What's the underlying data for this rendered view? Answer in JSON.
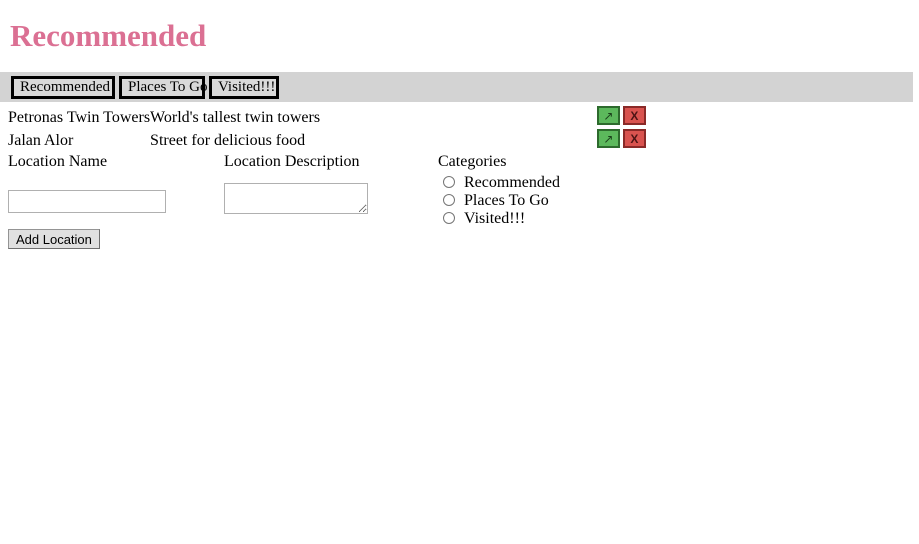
{
  "page": {
    "title": "Recommended",
    "title_color": "#db7093"
  },
  "navbar": {
    "background_color": "#d3d3d3",
    "buttons": [
      {
        "label": "Recommended"
      },
      {
        "label": "Places To Go"
      },
      {
        "label": "Visited!!!"
      }
    ]
  },
  "locations": {
    "rows": [
      {
        "name": "Petronas Twin Towers",
        "description": "World's tallest twin towers",
        "edit_label": "↗",
        "delete_label": "X"
      },
      {
        "name": "Jalan Alor",
        "description": "Street for delicious food",
        "edit_label": "↗",
        "delete_label": "X"
      }
    ],
    "edit_button_color": "#5cb85c",
    "delete_button_color": "#d9534f"
  },
  "form": {
    "name_label": "Location Name",
    "name_value": "",
    "name_placeholder": "",
    "description_label": "Location Description",
    "description_value": "",
    "description_placeholder": "",
    "categories_label": "Categories",
    "categories": [
      {
        "label": "Recommended",
        "checked": false
      },
      {
        "label": "Places To Go",
        "checked": false
      },
      {
        "label": "Visited!!!",
        "checked": false
      }
    ],
    "submit_label": "Add Location"
  }
}
